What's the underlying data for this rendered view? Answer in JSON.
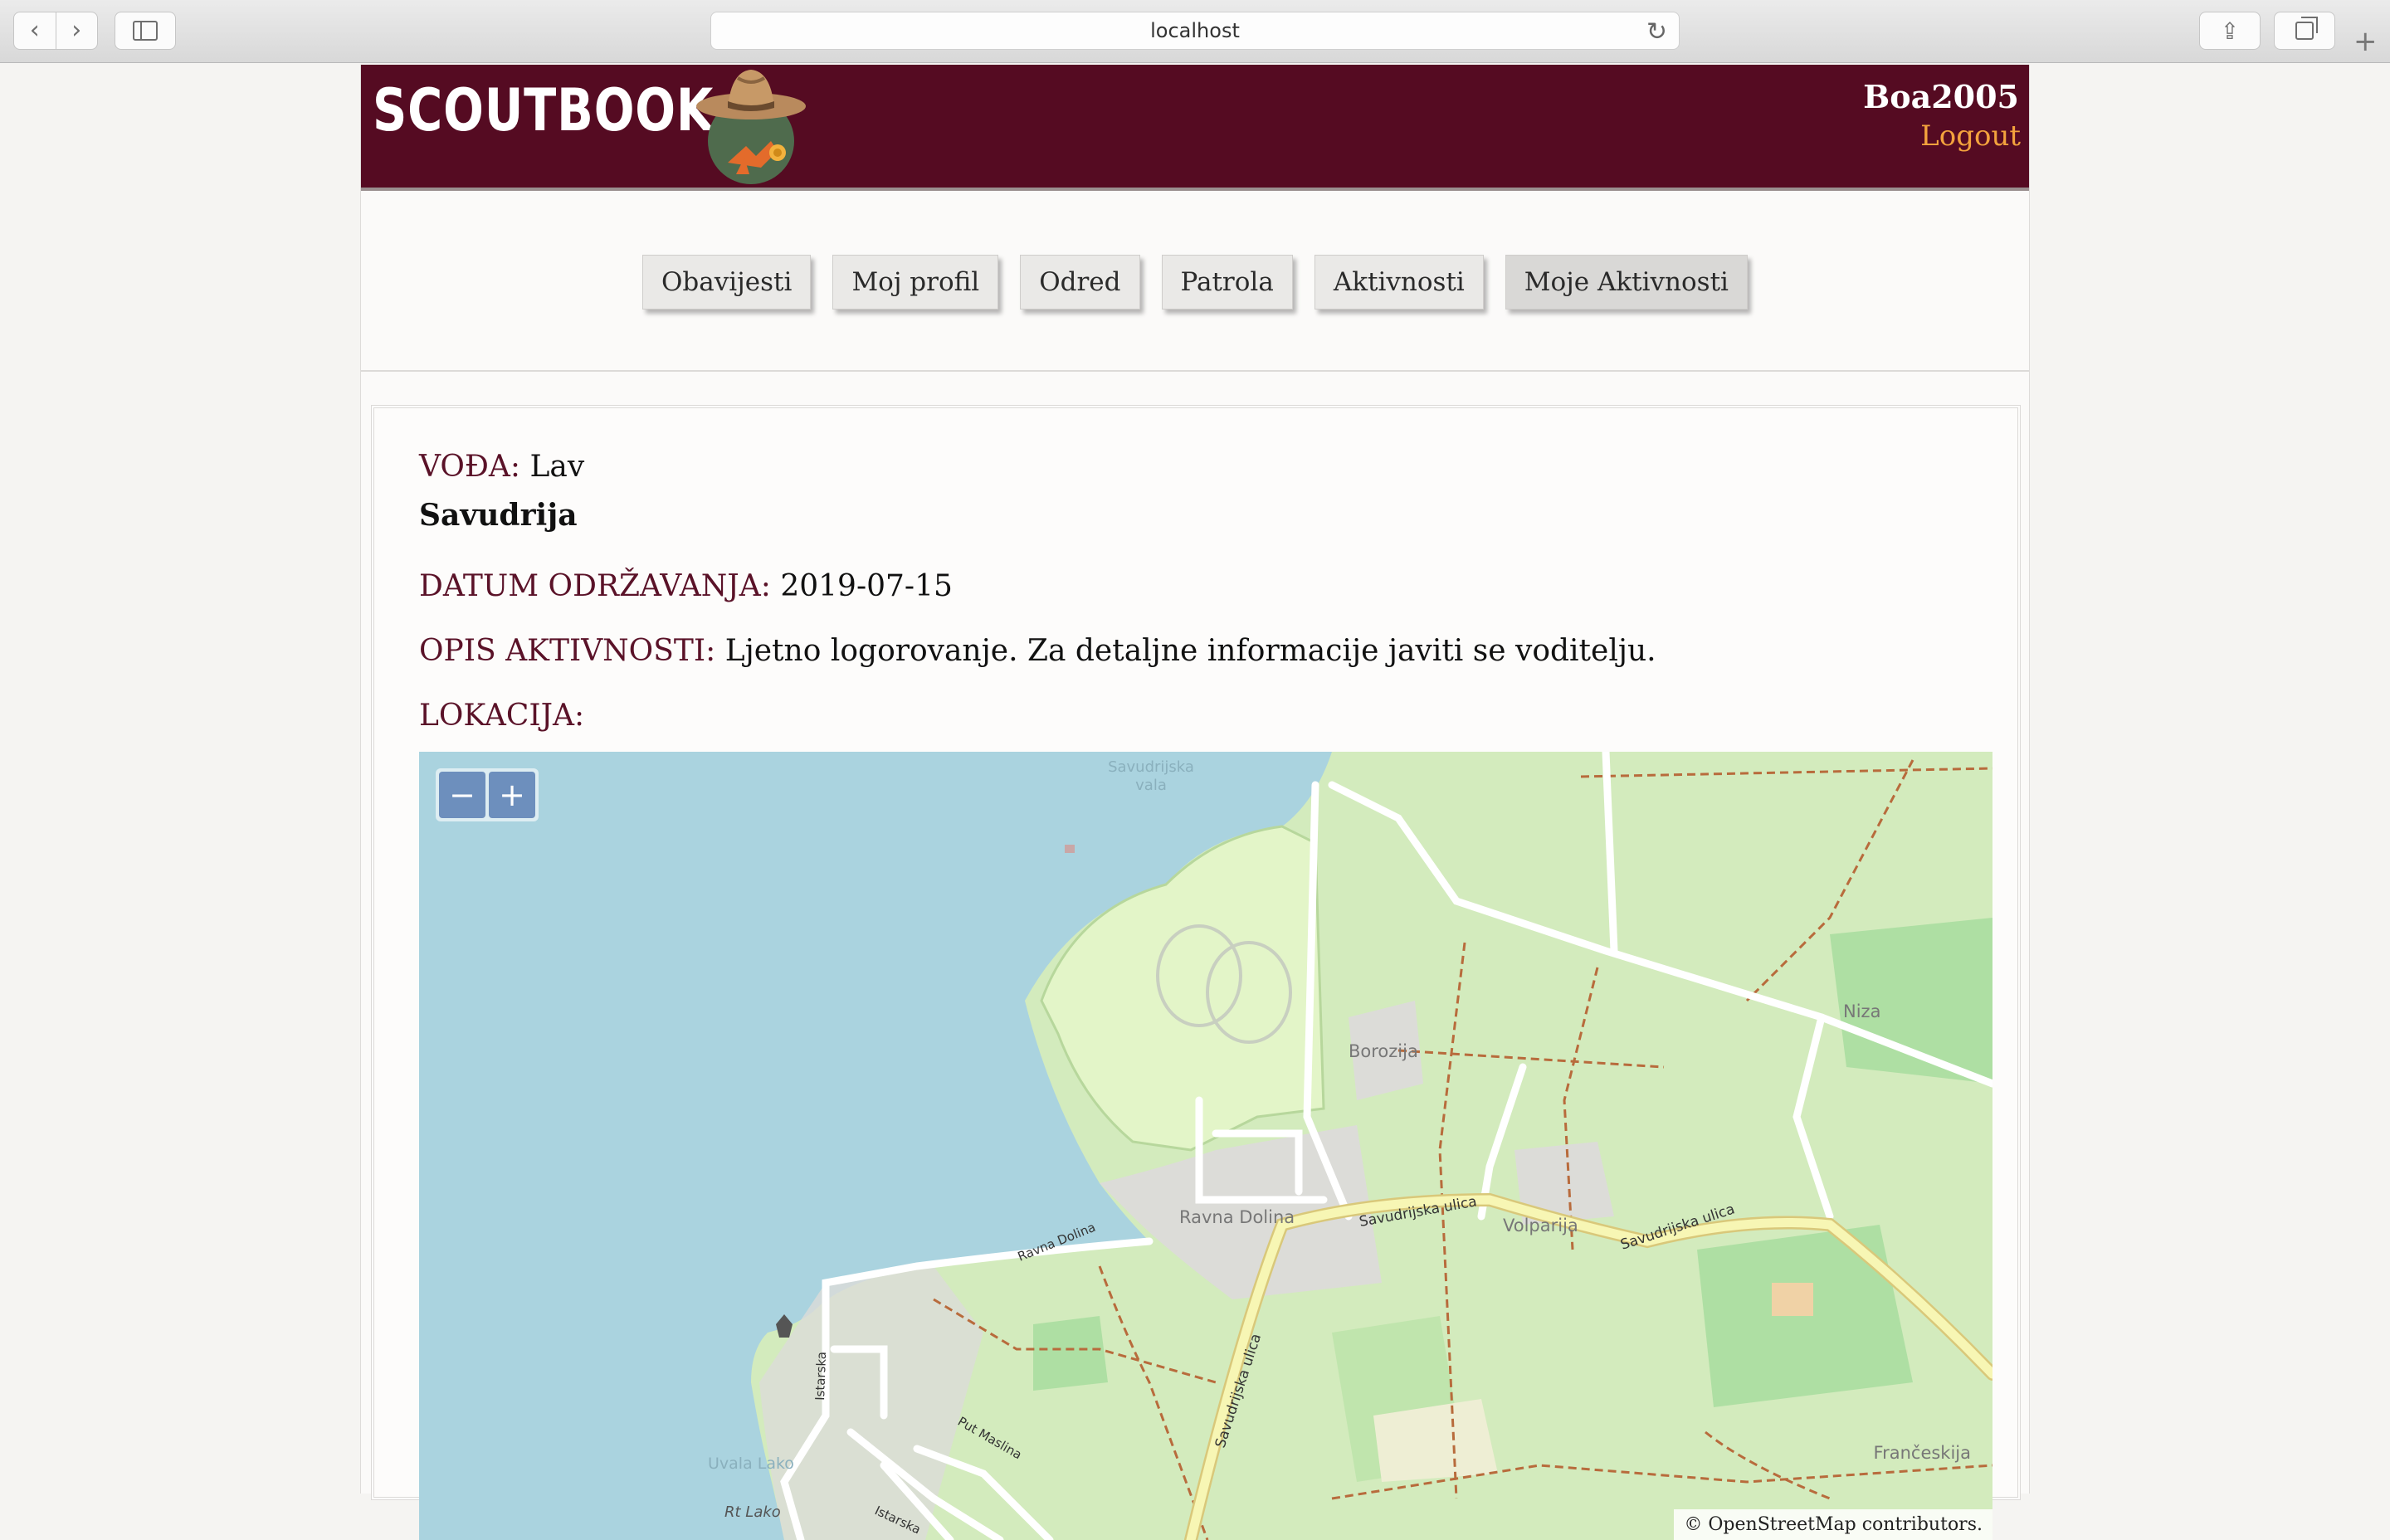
{
  "browser": {
    "back_icon": "‹",
    "forward_icon": "›",
    "address": "localhost",
    "reload_icon": "↻",
    "share_icon": "⇪",
    "new_tab_icon": "+"
  },
  "header": {
    "brand": "SCOUTBOOK",
    "username": "Boa2005",
    "logout": "Logout",
    "colors": {
      "background": "#550b22",
      "logout": "#f3a23d"
    }
  },
  "menu": {
    "items": [
      {
        "label": "Obavijesti"
      },
      {
        "label": "Moj profil"
      },
      {
        "label": "Odred"
      },
      {
        "label": "Patrola"
      },
      {
        "label": "Aktivnosti"
      },
      {
        "label": "Moje Aktivnosti"
      }
    ],
    "active": "Moje Aktivnosti"
  },
  "activity": {
    "leader_label": "VOĐA:",
    "leader": "Lav",
    "name": "Savudrija",
    "date_label": "DATUM ODRŽAVANJA:",
    "date": "2019-07-15",
    "description_label": "OPIS AKTIVNOSTI:",
    "description": "Ljetno logorovanje. Za detaljne informacije javiti se voditelju.",
    "location_label": "LOKACIJA:"
  },
  "map": {
    "zoom_out": "−",
    "zoom_in": "+",
    "attribution": "© OpenStreetMap contributors.",
    "labels": {
      "savudrijska_vala": [
        "Savudrijska",
        "vala"
      ],
      "borozija": "Borozija",
      "niza": "Niza",
      "ravna_dolina": "Ravna Dolina",
      "ravna_dolina_road": "Ravna Dolina",
      "volparija": "Volparija",
      "savudrijska_ulica_1": "Savudrijska ulica",
      "savudrijska_ulica_2": "Savudrijska ulica",
      "savudrijska_ulica_3": "Savudrijska ulica",
      "istarska_1": "Istarska",
      "istarska_2": "Istarska",
      "put_maslina": "Put Maslina",
      "uvala_lako": "Uvala Lako",
      "rt_lako": "Rt Lako",
      "franceskija": "Frančeskija"
    },
    "colors": {
      "sea": "#aad3df",
      "grass": "#d3ebbd",
      "park": "#e3f5c8",
      "road_main": "#f7f6b4",
      "track": "#b86b3c"
    }
  }
}
